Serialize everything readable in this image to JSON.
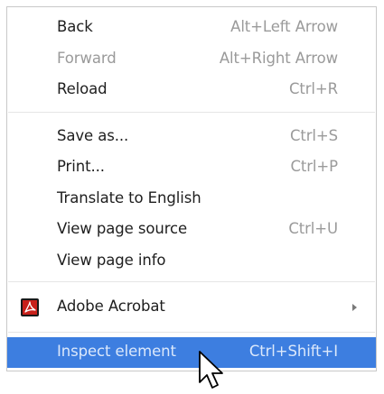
{
  "context_menu": {
    "items": [
      {
        "label": "Back",
        "shortcut": "Alt+Left Arrow"
      },
      {
        "label": "Forward",
        "shortcut": "Alt+Right Arrow",
        "disabled": true
      },
      {
        "label": "Reload",
        "shortcut": "Ctrl+R"
      },
      {
        "label": "Save as...",
        "shortcut": "Ctrl+S"
      },
      {
        "label": "Print...",
        "shortcut": "Ctrl+P"
      },
      {
        "label": "Translate to English",
        "shortcut": ""
      },
      {
        "label": "View page source",
        "shortcut": "Ctrl+U"
      },
      {
        "label": "View page info",
        "shortcut": ""
      },
      {
        "label": "Adobe Acrobat",
        "shortcut": "",
        "icon": "adobe-acrobat-icon",
        "submenu": true
      },
      {
        "label": "Inspect element",
        "shortcut": "Ctrl+Shift+I",
        "highlighted": true
      }
    ]
  },
  "colors": {
    "highlight": "#3d7ee0",
    "disabled_text": "#9a9a9a",
    "text": "#1e1e1e"
  }
}
